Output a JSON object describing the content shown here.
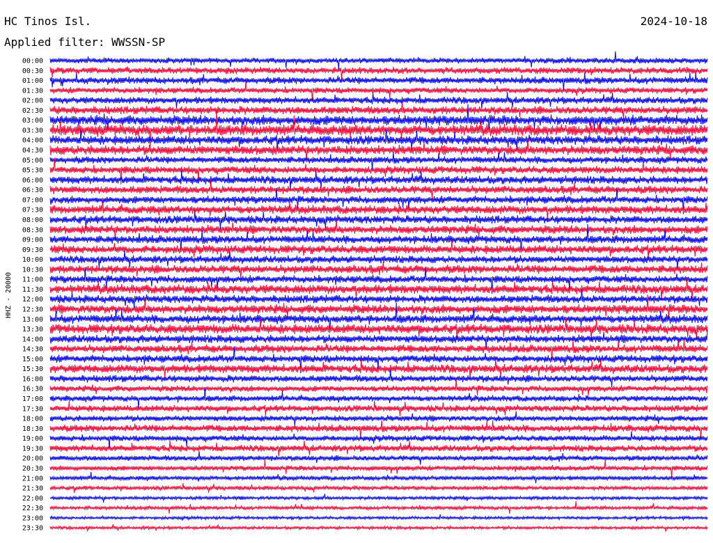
{
  "header": {
    "station": "HC Tinos Isl.",
    "date": "2024-10-18",
    "filter": "Applied filter: WWSSN-SP"
  },
  "chart_data": {
    "type": "line",
    "title": "HC Tinos Isl.",
    "subtitle": "Applied filter: WWSSN-SP",
    "ylabel": "HHZ - 20000",
    "xlabel": "",
    "grid": false,
    "trace_minutes": 30,
    "trace_colors": [
      "#0000ff",
      "#ff0033"
    ],
    "time_labels": [
      "00:00",
      "00:30",
      "01:00",
      "01:30",
      "02:00",
      "02:30",
      "03:00",
      "03:30",
      "04:00",
      "04:30",
      "05:00",
      "05:30",
      "06:00",
      "06:30",
      "07:00",
      "07:30",
      "08:00",
      "08:30",
      "09:00",
      "09:30",
      "10:00",
      "10:30",
      "11:00",
      "11:30",
      "12:00",
      "12:30",
      "13:00",
      "13:30",
      "14:00",
      "14:30",
      "15:00",
      "15:30",
      "16:00",
      "16:30",
      "17:00",
      "17:30",
      "18:00",
      "18:30",
      "19:00",
      "19:30",
      "20:00",
      "20:30",
      "21:00",
      "21:30",
      "22:00",
      "22:30",
      "23:00",
      "23:30"
    ],
    "noise_level": [
      0.55,
      0.65,
      0.7,
      0.6,
      0.7,
      0.8,
      1.0,
      1.1,
      0.9,
      0.95,
      0.7,
      0.75,
      0.8,
      0.8,
      0.75,
      0.85,
      0.8,
      0.85,
      0.8,
      0.85,
      0.75,
      0.85,
      0.75,
      0.9,
      0.8,
      0.9,
      0.85,
      0.95,
      0.8,
      0.8,
      0.75,
      0.85,
      0.7,
      0.6,
      0.6,
      0.65,
      0.6,
      0.7,
      0.6,
      0.65,
      0.55,
      0.5,
      0.45,
      0.4,
      0.35,
      0.35,
      0.3,
      0.3
    ]
  }
}
